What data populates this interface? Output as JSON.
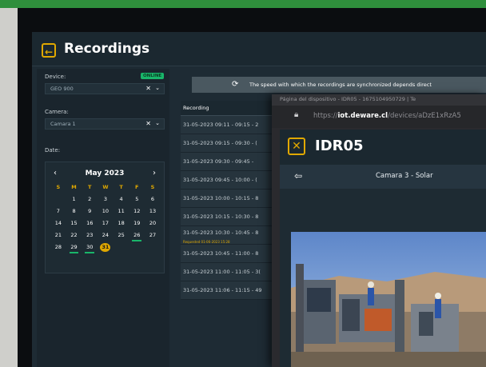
{
  "app": {
    "title": "Recordings",
    "back_icon": "arrow-left-icon"
  },
  "filters": {
    "device_label": "Device:",
    "status": "ONLINE",
    "device_value": "GEO 900",
    "camera_label": "Camera:",
    "camera_value": "Camara 1",
    "date_label": "Date:",
    "clear_symbol": "✕",
    "chevron_symbol": "⌄"
  },
  "calendar": {
    "month": "May 2023",
    "prev": "‹",
    "next": "›",
    "weekdays": [
      "S",
      "M",
      "T",
      "W",
      "T",
      "F",
      "S"
    ],
    "rows": [
      [
        "",
        "1",
        "2",
        "3",
        "4",
        "5",
        "6"
      ],
      [
        "7",
        "8",
        "9",
        "10",
        "11",
        "12",
        "13"
      ],
      [
        "14",
        "15",
        "16",
        "17",
        "18",
        "19",
        "20"
      ],
      [
        "21",
        "22",
        "23",
        "24",
        "25",
        "26",
        "27"
      ],
      [
        "28",
        "29",
        "30",
        "31",
        "",
        "",
        ""
      ]
    ],
    "marked_days": [
      "26",
      "29",
      "30"
    ],
    "selected_day": "31"
  },
  "banner": {
    "icon": "sync-icon",
    "text": "The speed with which the recordings are synchronized depends direct"
  },
  "table": {
    "header": "Recording",
    "rows": [
      {
        "text": "31-05-2023 09:11 - 09:15 - 2",
        "sub": ""
      },
      {
        "text": "31-05-2023 09:15 - 09:30 - (",
        "sub": ""
      },
      {
        "text": "31-05-2023 09:30 - 09:45 -",
        "sub": ""
      },
      {
        "text": "31-05-2023 09:45 - 10:00 - (",
        "sub": ""
      },
      {
        "text": "31-05-2023 10:00 - 10:15 - 8",
        "sub": ""
      },
      {
        "text": "31-05-2023 10:15 - 10:30 - 8",
        "sub": ""
      },
      {
        "text": "31-05-2023 10:30 - 10:45 - 8",
        "sub": "Requested 01-06-2023 15:28"
      },
      {
        "text": "31-05-2023 10:45 - 11:00 - 8",
        "sub": ""
      },
      {
        "text": "31-05-2023 11:00 - 11:05 - 3(",
        "sub": ""
      },
      {
        "text": "31-05-2023 11:06 - 11:15 - 49",
        "sub": ""
      }
    ]
  },
  "popup": {
    "window_title": "Página del dispositivo - IDR05 - 1675104950729 | Te",
    "url_prefix": "https://",
    "url_domain": "iot.deware.cl",
    "url_path": "/devices/aDzE1xRzA5",
    "device_title": "IDR05",
    "close_symbol": "✕",
    "camera_name": "Camara 3 - Solar"
  }
}
